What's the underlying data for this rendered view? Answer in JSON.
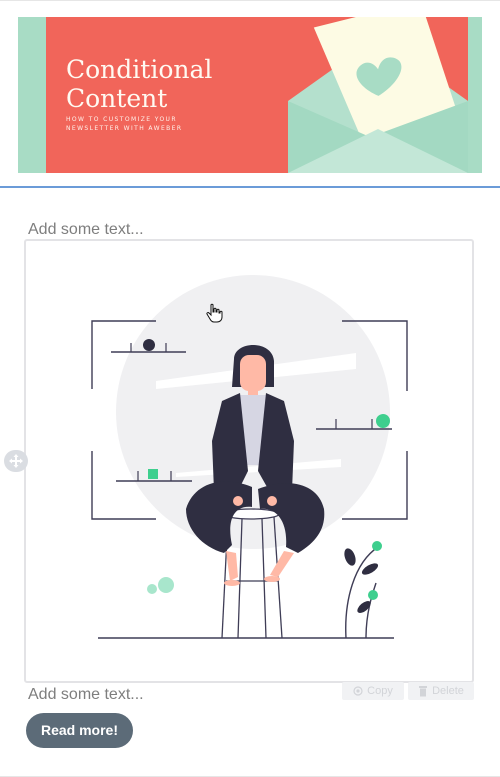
{
  "banner": {
    "title_line1": "Conditional",
    "title_line2": "Content",
    "subtitle_line1": "HOW TO CUSTOMIZE YOUR",
    "subtitle_line2": "NEWSLETTER WITH AWEBER"
  },
  "editor": {
    "placeholder_top": "Add some text...",
    "placeholder_bottom": "Add some text...",
    "copy_label": "Copy",
    "delete_label": "Delete",
    "button_label": "Read more!"
  },
  "icons": {
    "drag": "move-arrows-icon",
    "cursor": "hand-pointer-icon",
    "copy": "copy-icon",
    "delete": "trash-icon",
    "envelope": "heart-envelope-icon"
  },
  "colors": {
    "banner_coral": "#f1655a",
    "banner_mint": "#a8dcc5",
    "editor_accent": "#6b9bd8",
    "button_bg": "#5c6b78",
    "illustration_green": "#3ecf8e",
    "illustration_navy": "#2f2e41"
  }
}
